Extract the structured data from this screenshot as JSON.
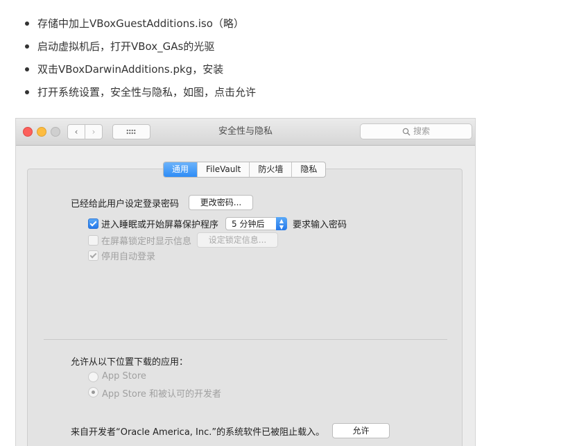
{
  "bullets": [
    "存储中加上VBoxGuestAdditions.iso（略）",
    "启动虚拟机后，打开VBox_GAs的光驱",
    "双击VBoxDarwinAdditions.pkg，安装",
    "打开系统设置，安全性与隐私，如图，点击允许"
  ],
  "window": {
    "title": "安全性与隐私",
    "search_placeholder": "搜索",
    "nav_back": "‹",
    "nav_forward": "›"
  },
  "tabs": [
    "通用",
    "FileVault",
    "防火墙",
    "隐私"
  ],
  "active_tab": "通用",
  "general": {
    "password_label": "已经给此用户设定登录密码",
    "change_password_button": "更改密码...",
    "require_password_prefix": "进入睡眠或开始屏幕保护程序",
    "require_password_value": "5 分钟后",
    "require_password_suffix": "要求输入密码",
    "show_message_label": "在屏幕锁定时显示信息",
    "set_lock_message_button": "设定锁定信息...",
    "disable_autologin_label": "停用自动登录",
    "allow_apps_label": "允许从以下位置下载的应用：",
    "radio_app_store": "App Store",
    "radio_app_store_dev": "App Store 和被认可的开发者",
    "blocked_message": "来自开发者“Oracle America, Inc.”的系统软件已被阻止载入。",
    "allow_button": "允许"
  },
  "colors": {
    "accent": "#2e8cf6",
    "close": "#fc605c",
    "minimize": "#fdbc40"
  }
}
